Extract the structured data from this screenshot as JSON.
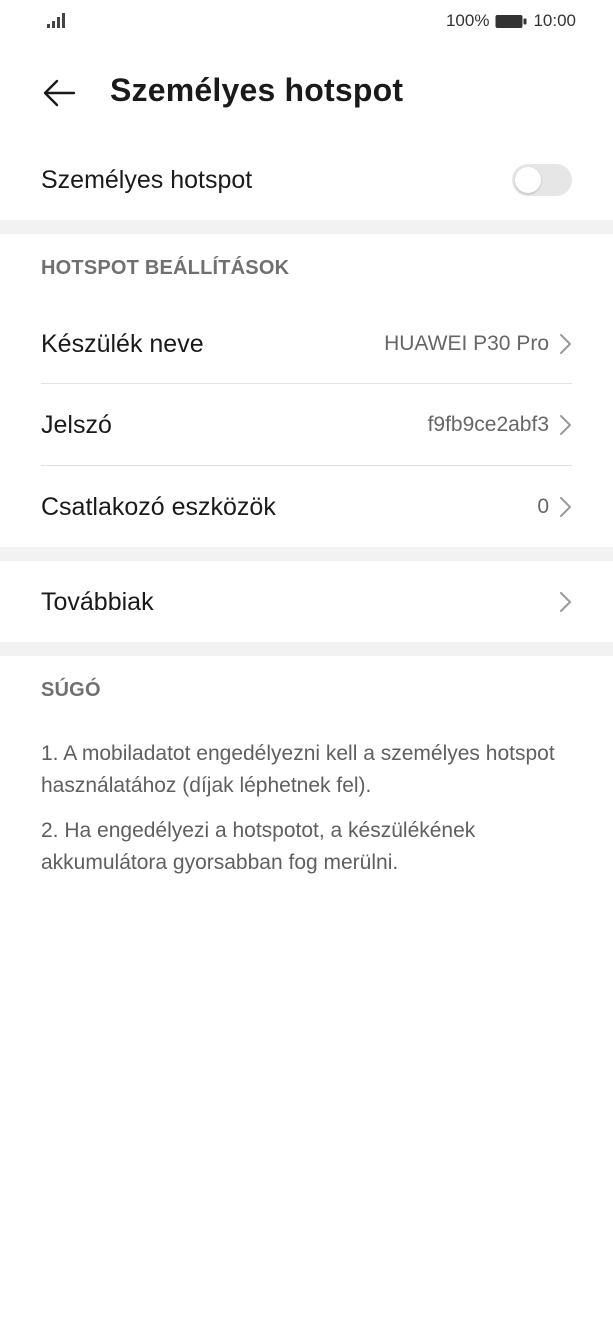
{
  "status_bar": {
    "signal_icon": "signal-bars-icon",
    "battery_percent": "100%",
    "battery_icon": "battery-icon",
    "time": "10:00"
  },
  "header": {
    "back_icon": "arrow-left-icon",
    "title": "Személyes hotspot"
  },
  "hotspot_toggle": {
    "label": "Személyes hotspot",
    "enabled": false,
    "track_color": "#e6e6e6"
  },
  "settings_section": {
    "title": "HOTSPOT BEÁLLÍTÁSOK",
    "items": [
      {
        "label": "Készülék neve",
        "value": "HUAWEI P30 Pro"
      },
      {
        "label": "Jelszó",
        "value": "f9fb9ce2abf3"
      },
      {
        "label": "Csatlakozó eszközök",
        "value": "0"
      }
    ]
  },
  "more": {
    "label": "Továbbiak"
  },
  "help_section": {
    "title": "SÚGÓ",
    "paragraphs": [
      "1. A mobiladatot engedélyezni kell a személyes hotspot használatához (díjak léphetnek fel).",
      "2. Ha engedélyezi a hotspotot, a készülékének akkumulátora gyorsabban fog merülni."
    ]
  },
  "colors": {
    "background": "#ffffff",
    "separator_band": "#f2f2f2",
    "primary_text": "#1a1a1a",
    "secondary_text": "#666666"
  }
}
